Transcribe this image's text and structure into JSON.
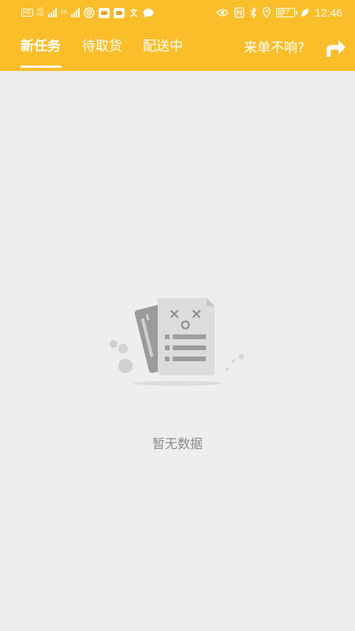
{
  "status_bar": {
    "left_box_label": "HD",
    "net_top": "4G",
    "net_bottom": "HD",
    "net2_label": "2G",
    "battery_level": "37",
    "time": "12:46"
  },
  "tabs": [
    {
      "label": "新任务",
      "active": true
    },
    {
      "label": "待取货",
      "active": false
    },
    {
      "label": "配送中",
      "active": false
    }
  ],
  "header": {
    "no_ring_label": "来单不响?",
    "share_icon": "share-arrow-icon"
  },
  "empty_state": {
    "icon": "empty-documents-icon",
    "text": "暂无数据"
  },
  "colors": {
    "brand": "#f9be2a",
    "background": "#eeeeee",
    "empty_text": "#8a8a8a"
  }
}
